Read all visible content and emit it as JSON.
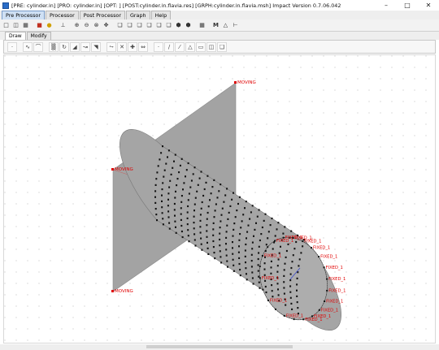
{
  "window": {
    "title": "[PRE: cylinder.in] [PRO: cylinder.in] [OPT: ] [POST:cylinder.in.flavia.res] [GRPH:cylinder.in.flavia.msh] Impact Version 0.7.06.042",
    "minimize": "–",
    "maximize": "□",
    "close": "✕"
  },
  "tabs": [
    {
      "label": "Pre Processor",
      "active": true
    },
    {
      "label": "Processor",
      "active": false
    },
    {
      "label": "Post Processor",
      "active": false
    },
    {
      "label": "Graph",
      "active": false
    },
    {
      "label": "Help",
      "active": false
    }
  ],
  "subtabs": [
    {
      "label": "Draw",
      "active": true
    },
    {
      "label": "Modify",
      "active": false
    }
  ],
  "toolbar1_icons": [
    "new-file-icon",
    "open-folder-icon",
    "save-icon",
    "separator",
    "mesh-icon",
    "render-icon",
    "separator",
    "measure-icon",
    "separator",
    "zoom-in-icon",
    "zoom-out-icon",
    "zoom-window-icon",
    "pan-icon",
    "separator",
    "view-front-icon",
    "view-back-icon",
    "view-left-icon",
    "view-right-icon",
    "view-top-icon",
    "view-bottom-icon",
    "view-iso-icon",
    "view-3d-icon",
    "separator",
    "node-icon",
    "separator",
    "mode-m-icon",
    "triangle-icon",
    "axis-icon"
  ],
  "toolbar1_glyphs": {
    "M": "M"
  },
  "toolbar2_icons": [
    "point-icon",
    "separator",
    "curve-icon",
    "arc-icon",
    "separator",
    "surface-icon",
    "revolve-icon",
    "extrude-icon",
    "sweep-icon",
    "loft-icon",
    "separator",
    "split-icon",
    "cross-icon",
    "copy-icon",
    "mirror-icon",
    "separator",
    "node-icon",
    "line-icon",
    "slash-icon",
    "triangle-icon",
    "rectangle-icon",
    "element-icon",
    "solid-icon"
  ],
  "labels": {
    "moving_top": "MOVING",
    "moving_mid": "MOVING",
    "moving_bottom": "MOVING",
    "fixed": "FIXED_1"
  },
  "colors": {
    "plane": "#a0a0a0",
    "label": "#e00000",
    "node": "#111111"
  }
}
